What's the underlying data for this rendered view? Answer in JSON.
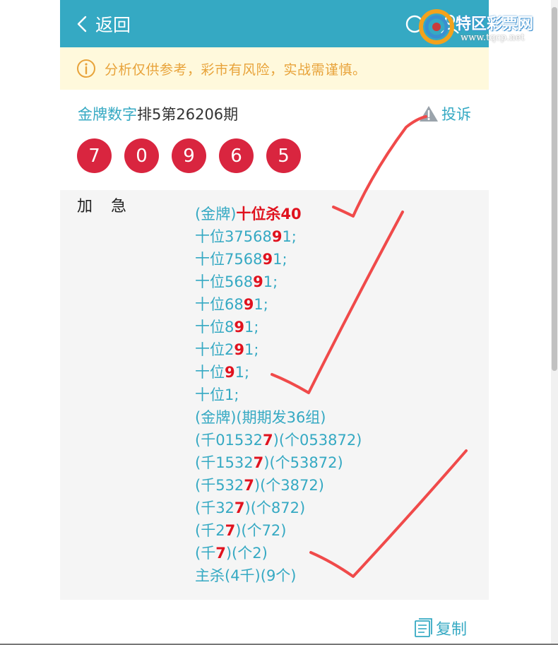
{
  "header": {
    "back_label": "返回"
  },
  "notice": {
    "text": "分析仅供参考，彩市有风险，实战需谨慎。"
  },
  "title": {
    "name": "金牌数字",
    "issue": "排5第26206期",
    "complain_label": "投诉"
  },
  "balls": [
    "7",
    "0",
    "9",
    "6",
    "5"
  ],
  "content": {
    "label": "加　急",
    "lines": [
      {
        "segments": [
          {
            "t": "(金牌)"
          },
          {
            "t": "十位杀40",
            "hl": true
          }
        ]
      },
      {
        "segments": [
          {
            "t": "十位37568"
          },
          {
            "t": "9",
            "hl": true
          },
          {
            "t": "1;"
          }
        ]
      },
      {
        "segments": [
          {
            "t": "十位7568"
          },
          {
            "t": "9",
            "hl": true
          },
          {
            "t": "1;"
          }
        ]
      },
      {
        "segments": [
          {
            "t": "十位568"
          },
          {
            "t": "9",
            "hl": true
          },
          {
            "t": "1;"
          }
        ]
      },
      {
        "segments": [
          {
            "t": "十位68"
          },
          {
            "t": "9",
            "hl": true
          },
          {
            "t": "1;"
          }
        ]
      },
      {
        "segments": [
          {
            "t": "十位8"
          },
          {
            "t": "9",
            "hl": true
          },
          {
            "t": "1;"
          }
        ]
      },
      {
        "segments": [
          {
            "t": "十位2"
          },
          {
            "t": "9",
            "hl": true
          },
          {
            "t": "1;"
          }
        ]
      },
      {
        "segments": [
          {
            "t": "十位"
          },
          {
            "t": "9",
            "hl": true
          },
          {
            "t": "1;"
          }
        ]
      },
      {
        "segments": [
          {
            "t": "十位1;"
          }
        ]
      },
      {
        "segments": [
          {
            "t": "(金牌)(期期发36组)"
          }
        ]
      },
      {
        "segments": [
          {
            "t": "(千01532"
          },
          {
            "t": "7",
            "hl": true
          },
          {
            "t": ")(个053872)"
          }
        ]
      },
      {
        "segments": [
          {
            "t": "(千1532"
          },
          {
            "t": "7",
            "hl": true
          },
          {
            "t": ")(个53872)"
          }
        ]
      },
      {
        "segments": [
          {
            "t": "(千532"
          },
          {
            "t": "7",
            "hl": true
          },
          {
            "t": ")(个3872)"
          }
        ]
      },
      {
        "segments": [
          {
            "t": "(千32"
          },
          {
            "t": "7",
            "hl": true
          },
          {
            "t": ")(个872)"
          }
        ]
      },
      {
        "segments": [
          {
            "t": "(千2"
          },
          {
            "t": "7",
            "hl": true
          },
          {
            "t": ")(个72)"
          }
        ]
      },
      {
        "segments": [
          {
            "t": "(千"
          },
          {
            "t": "7",
            "hl": true
          },
          {
            "t": ")(个2)"
          }
        ]
      },
      {
        "segments": [
          {
            "t": "主杀(4千)(9个)"
          }
        ]
      }
    ]
  },
  "copy_label": "复制",
  "watermark": {
    "name": "特区彩票网",
    "url": "www.tqcp.net"
  },
  "colors": {
    "accent": "#35a9c3",
    "ball": "#d9253f",
    "highlight": "#e0121e",
    "notice_bg": "#fff9dc",
    "notice_text": "#e8a33a",
    "annotation": "#f04a4a"
  }
}
